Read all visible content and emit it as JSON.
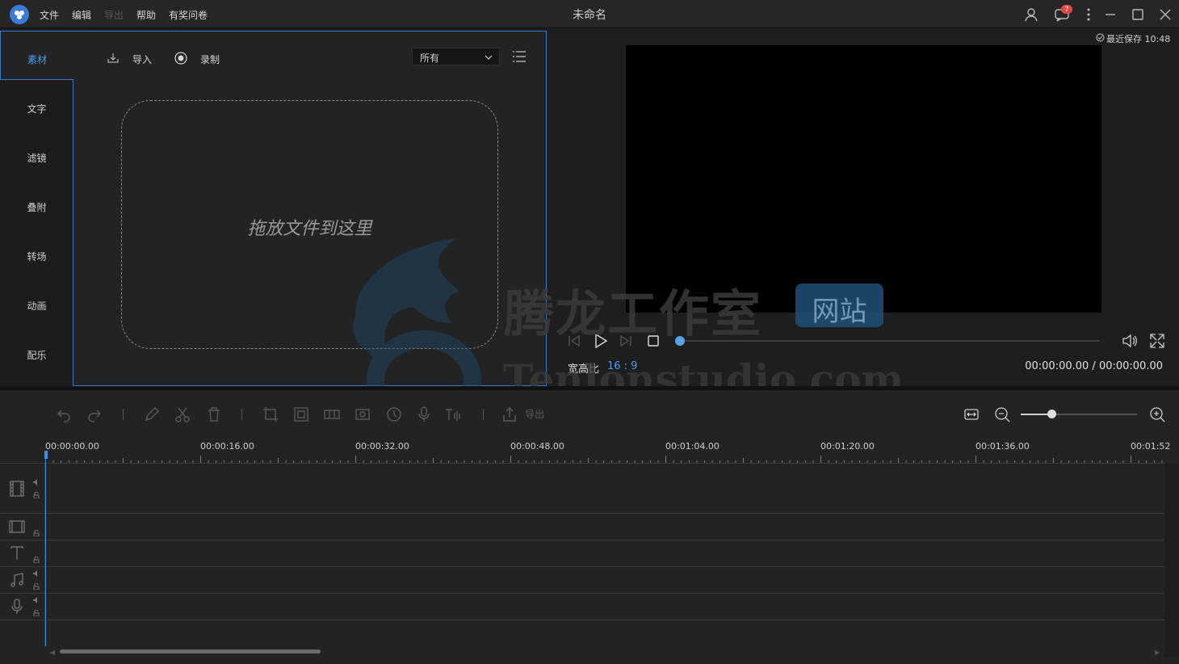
{
  "window": {
    "title": "未命名"
  },
  "menu": {
    "file": "文件",
    "edit": "编辑",
    "export": "导出",
    "help": "帮助",
    "survey": "有奖问卷"
  },
  "titlebar": {
    "notification_count": "7",
    "icons": [
      "user-icon",
      "chat-icon",
      "more-icon",
      "minimize-icon",
      "maximize-icon",
      "close-icon"
    ]
  },
  "media_panel": {
    "categories": [
      "素材",
      "文字",
      "滤镜",
      "叠附",
      "转场",
      "动画",
      "配乐"
    ],
    "active_category": "素材",
    "import_label": "导入",
    "record_label": "录制",
    "filter_value": "所有",
    "dropzone_text": "拖放文件到这里"
  },
  "preview": {
    "save_status": "最近保存 10:48",
    "aspect_label": "宽高比",
    "aspect_value": "16 : 9",
    "timecode": "00:00:00.00 / 00:00:00.00",
    "progress": 0
  },
  "timeline": {
    "export_label": "导出",
    "ruler_labels": [
      "00:00:00.00",
      "00:00:16.00",
      "00:00:32.00",
      "00:00:48.00",
      "00:01:04.00",
      "00:01:20.00",
      "00:01:36.00",
      "00:01:52"
    ],
    "zoom_level": 0.27,
    "tracks": [
      "video-track",
      "overlay-track",
      "text-track",
      "music-track",
      "voice-track"
    ]
  },
  "watermark": {
    "cn_text": "腾龙工作室",
    "badge_text": "网站",
    "en_text": "Tenlonstudio.com"
  },
  "colors": {
    "accent": "#4a9df0",
    "panel_border": "#3c7ac6",
    "background": "#1e1e1e",
    "badge": "#e04848"
  }
}
